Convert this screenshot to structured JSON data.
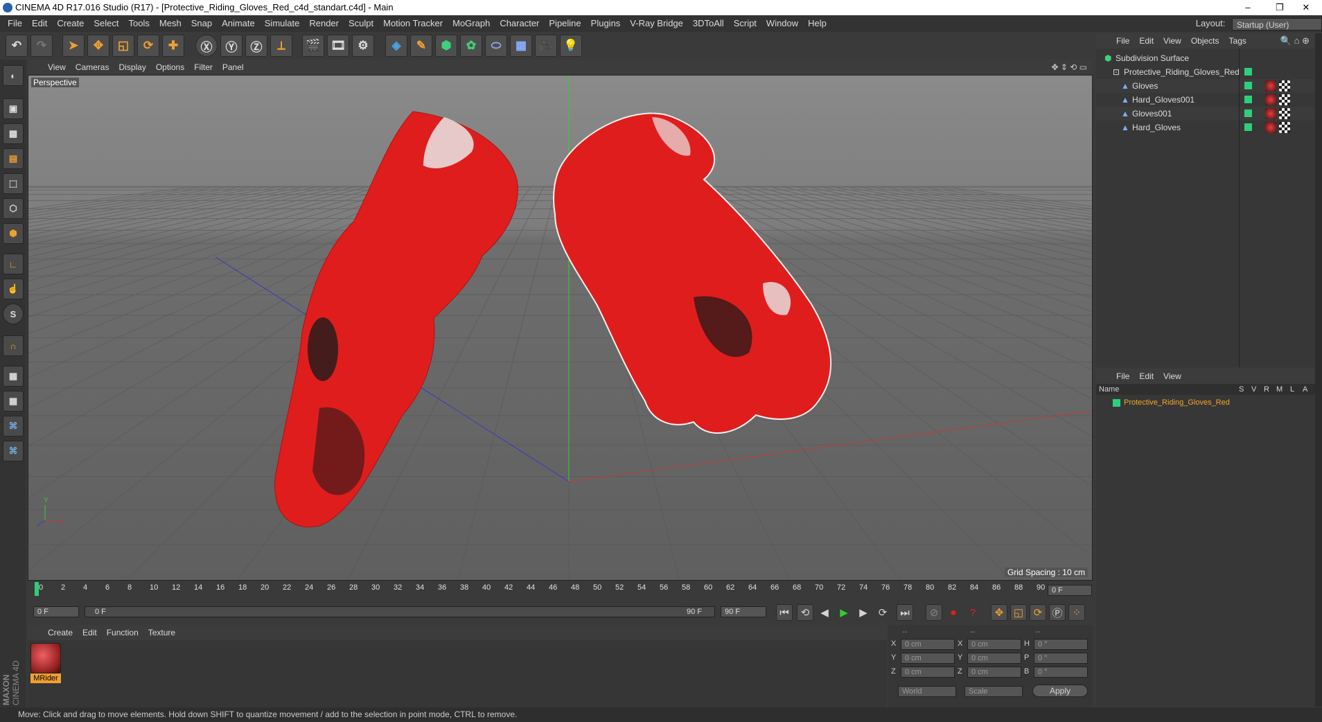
{
  "window": {
    "title": "CINEMA 4D R17.016 Studio (R17) - [Protective_Riding_Gloves_Red_c4d_standart.c4d] - Main",
    "minimize": "–",
    "restore": "❐",
    "close": "✕"
  },
  "menu": [
    "File",
    "Edit",
    "Create",
    "Select",
    "Tools",
    "Mesh",
    "Snap",
    "Animate",
    "Simulate",
    "Render",
    "Sculpt",
    "Motion Tracker",
    "MoGraph",
    "Character",
    "Pipeline",
    "Plugins",
    "V-Ray Bridge",
    "3DToAll",
    "Script",
    "Window",
    "Help"
  ],
  "layout": {
    "label": "Layout:",
    "value": "Startup (User)"
  },
  "viewport": {
    "menu": [
      "View",
      "Cameras",
      "Display",
      "Options",
      "Filter",
      "Panel"
    ],
    "camera_label": "Perspective",
    "grid_spacing": "Grid Spacing : 10 cm",
    "axis_x": "X",
    "axis_y": "Y",
    "glove_color": "#e01d1d"
  },
  "timeline": {
    "ticks": [
      "0",
      "2",
      "4",
      "6",
      "8",
      "10",
      "12",
      "14",
      "16",
      "18",
      "20",
      "22",
      "24",
      "26",
      "28",
      "30",
      "32",
      "34",
      "36",
      "38",
      "40",
      "42",
      "44",
      "46",
      "48",
      "50",
      "52",
      "54",
      "56",
      "58",
      "60",
      "62",
      "64",
      "66",
      "68",
      "70",
      "72",
      "74",
      "76",
      "78",
      "80",
      "82",
      "84",
      "86",
      "88",
      "90"
    ],
    "current_frame_field": "0 F",
    "start_field": "0 F",
    "range_start": "0 F",
    "range_end": "90 F",
    "end_field": "90 F"
  },
  "materials": {
    "menu": [
      "Create",
      "Edit",
      "Function",
      "Texture"
    ],
    "items": [
      {
        "name": "MRider"
      }
    ]
  },
  "coords": {
    "headers": [
      "--",
      "--",
      "--"
    ],
    "rows": [
      {
        "a": "X",
        "a_val": "0 cm",
        "b": "X",
        "b_val": "0 cm",
        "c": "H",
        "c_val": "0 °"
      },
      {
        "a": "Y",
        "a_val": "0 cm",
        "b": "Y",
        "b_val": "0 cm",
        "c": "P",
        "c_val": "0 °"
      },
      {
        "a": "Z",
        "a_val": "0 cm",
        "b": "Z",
        "b_val": "0 cm",
        "c": "B",
        "c_val": "0 °"
      }
    ],
    "mode": "World",
    "scale": "Scale",
    "apply": "Apply"
  },
  "objects": {
    "menu": [
      "File",
      "Edit",
      "View",
      "Objects",
      "Tags"
    ],
    "tree": [
      {
        "name": "Subdivision Surface",
        "level": 0
      },
      {
        "name": "Protective_Riding_Gloves_Red",
        "level": 1
      },
      {
        "name": "Gloves",
        "level": 2
      },
      {
        "name": "Hard_Gloves001",
        "level": 2
      },
      {
        "name": "Gloves001",
        "level": 2
      },
      {
        "name": "Hard_Gloves",
        "level": 2
      }
    ]
  },
  "attributes": {
    "menu": [
      "File",
      "Edit",
      "View"
    ],
    "columns": [
      "Name",
      "S",
      "V",
      "R",
      "M",
      "L",
      "A"
    ],
    "layer": "Protective_Riding_Gloves_Red",
    "layer_color": "#f5a623"
  },
  "status": "Move: Click and drag to move elements. Hold down SHIFT to quantize movement / add to the selection in point mode, CTRL to remove.",
  "brand": {
    "line1": "MAXON",
    "line2": "CINEMA 4D"
  }
}
